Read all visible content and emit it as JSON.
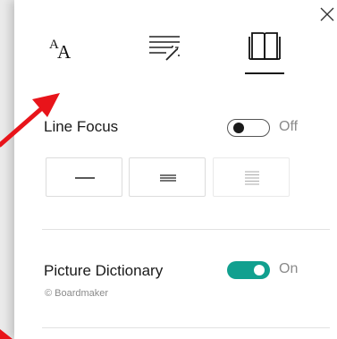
{
  "window": {
    "close_glyph": "×"
  },
  "toolbar": {
    "text_size_label": "AA",
    "tabs": [
      "text-preferences",
      "grammar-options",
      "reading-preferences"
    ],
    "active_tab": "reading-preferences"
  },
  "line_focus": {
    "label": "Line Focus",
    "toggle_state": "Off",
    "options": [
      "one-line",
      "three-lines",
      "five-lines"
    ]
  },
  "picture_dictionary": {
    "label": "Picture Dictionary",
    "toggle_state": "On",
    "credit": "© Boardmaker"
  },
  "colors": {
    "accent": "#11a08f",
    "arrow": "#e8141a"
  }
}
